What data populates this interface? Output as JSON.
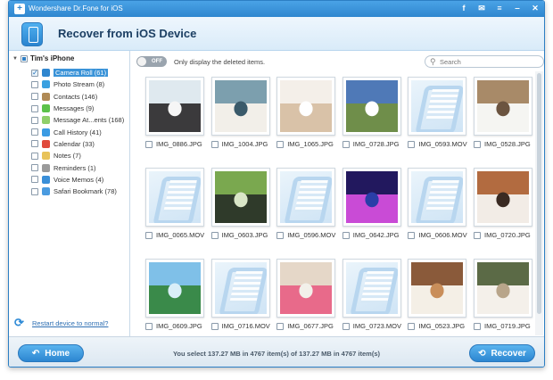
{
  "app": {
    "title": "Wondershare Dr.Fone for iOS"
  },
  "titlebar_icons": [
    {
      "name": "facebook-icon",
      "glyph": "f"
    },
    {
      "name": "feedback-icon",
      "glyph": "✉"
    },
    {
      "name": "menu-icon",
      "glyph": "≡"
    },
    {
      "name": "minimize-icon",
      "glyph": "‒"
    },
    {
      "name": "close-icon",
      "glyph": "✕"
    }
  ],
  "header": {
    "title": "Recover from iOS Device"
  },
  "sidebar": {
    "root_label": "Tim's iPhone",
    "items": [
      {
        "label": "Camera Roll (61)",
        "icon_color": "#2f86cf",
        "checked": true,
        "selected": true
      },
      {
        "label": "Photo Stream (8)",
        "icon_color": "#3aa0e0",
        "checked": false,
        "selected": false
      },
      {
        "label": "Contacts (146)",
        "icon_color": "#b08a55",
        "checked": false,
        "selected": false
      },
      {
        "label": "Messages (9)",
        "icon_color": "#5cc24a",
        "checked": false,
        "selected": false
      },
      {
        "label": "Message At...ents (168)",
        "icon_color": "#8fcf6a",
        "checked": false,
        "selected": false
      },
      {
        "label": "Call History (41)",
        "icon_color": "#3b9be3",
        "checked": false,
        "selected": false
      },
      {
        "label": "Calendar (33)",
        "icon_color": "#e04a3c",
        "checked": false,
        "selected": false
      },
      {
        "label": "Notes (7)",
        "icon_color": "#e8c35a",
        "checked": false,
        "selected": false
      },
      {
        "label": "Reminders (1)",
        "icon_color": "#9a9a9a",
        "checked": false,
        "selected": false
      },
      {
        "label": "Voice Memos (4)",
        "icon_color": "#3a8fd8",
        "checked": false,
        "selected": false
      },
      {
        "label": "Safari Bookmark (78)",
        "icon_color": "#4a9be0",
        "checked": false,
        "selected": false
      }
    ],
    "restart_label": "Restart device to normal?"
  },
  "toolbar": {
    "toggle_label": "OFF",
    "only_label": "Only display the deleted items.",
    "search_placeholder": "Search"
  },
  "files": [
    {
      "name": "IMG_0886.JPG",
      "kind": "photo",
      "colors": [
        "#dfe9ef",
        "#3b3a3c",
        "#f6f6f6"
      ]
    },
    {
      "name": "IMG_1004.JPG",
      "kind": "photo",
      "colors": [
        "#7c9fae",
        "#f2efe9",
        "#3a5a6a"
      ]
    },
    {
      "name": "IMG_1065.JPG",
      "kind": "photo",
      "colors": [
        "#f4efe9",
        "#d9c2a8",
        "#ffffff"
      ]
    },
    {
      "name": "IMG_0728.JPG",
      "kind": "photo",
      "colors": [
        "#4f79b7",
        "#6f8e4a",
        "#ffffff"
      ]
    },
    {
      "name": "IMG_0593.MOV",
      "kind": "video",
      "colors": []
    },
    {
      "name": "IMG_0528.JPG",
      "kind": "photo",
      "colors": [
        "#a88a68",
        "#f5f5f2",
        "#6b5440"
      ]
    },
    {
      "name": "IMG_0065.MOV",
      "kind": "video",
      "colors": []
    },
    {
      "name": "IMG_0603.JPG",
      "kind": "photo",
      "colors": [
        "#7aa84f",
        "#2f3a2a",
        "#d9e6c7"
      ]
    },
    {
      "name": "IMG_0596.MOV",
      "kind": "video",
      "colors": []
    },
    {
      "name": "IMG_0642.JPG",
      "kind": "photo",
      "colors": [
        "#22185e",
        "#c94bd6",
        "#2a3ea8"
      ]
    },
    {
      "name": "IMG_0606.MOV",
      "kind": "video",
      "colors": []
    },
    {
      "name": "IMG_0720.JPG",
      "kind": "photo",
      "colors": [
        "#b26b40",
        "#f2ece6",
        "#3a2a22"
      ]
    },
    {
      "name": "IMG_0609.JPG",
      "kind": "photo",
      "colors": [
        "#7fc0e8",
        "#3a8a4a",
        "#d9eef8"
      ]
    },
    {
      "name": "IMG_0716.MOV",
      "kind": "video",
      "colors": []
    },
    {
      "name": "IMG_0677.JPG",
      "kind": "photo",
      "colors": [
        "#e5d7c8",
        "#e86a8a",
        "#f2f0ea"
      ]
    },
    {
      "name": "IMG_0723.MOV",
      "kind": "video",
      "colors": []
    },
    {
      "name": "IMG_0523.JPG",
      "kind": "photo",
      "colors": [
        "#8a5a3a",
        "#f4efe6",
        "#c98e5a"
      ]
    },
    {
      "name": "IMG_0719.JPG",
      "kind": "photo",
      "colors": [
        "#5b6a46",
        "#f4f0ea",
        "#b8a58a"
      ]
    }
  ],
  "footer": {
    "home_label": "Home",
    "recover_label": "Recover",
    "status": "You select 137.27 MB in 4767 item(s) of 137.27 MB in 4767 item(s)"
  },
  "accent_color": "#2f86cf"
}
